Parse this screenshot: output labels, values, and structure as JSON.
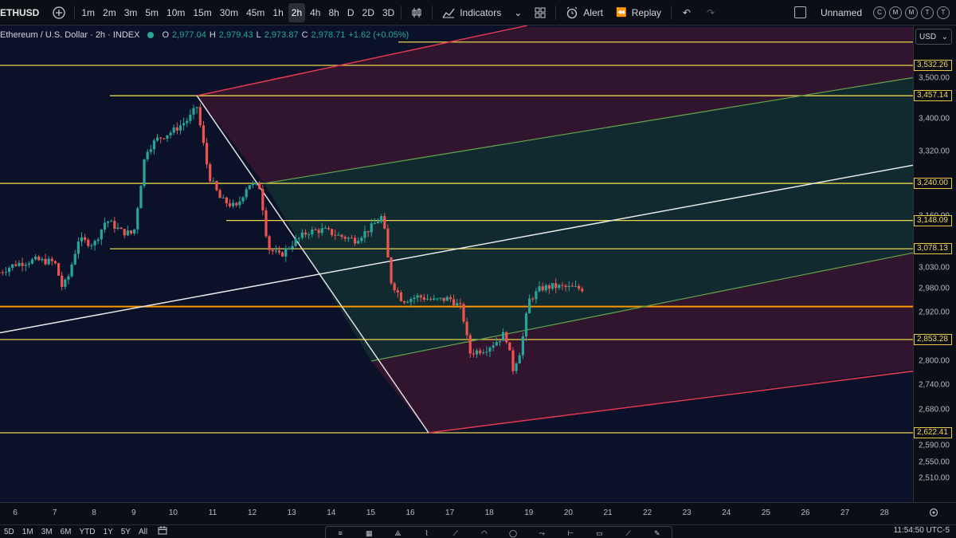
{
  "toolbar": {
    "symbol": "ETHUSD",
    "timeframes": [
      "1m",
      "2m",
      "3m",
      "5m",
      "10m",
      "15m",
      "30m",
      "45m",
      "1h",
      "2h",
      "4h",
      "8h",
      "D",
      "2D",
      "3D"
    ],
    "active_timeframe": "2h",
    "indicators_label": "Indicators",
    "alert_label": "Alert",
    "replay_label": "Replay",
    "layout_name": "Unnamed",
    "circle_buttons": [
      "C",
      "M",
      "M",
      "T",
      "T"
    ]
  },
  "legend": {
    "title": "Ethereum / U.S. Dollar · 2h · INDEX",
    "o_label": "O",
    "o": "2,977.04",
    "h_label": "H",
    "h": "2,979.43",
    "l_label": "L",
    "l": "2,973.87",
    "c_label": "C",
    "c": "2,978.71",
    "change": "+1.62 (+0.05%)"
  },
  "price_axis": {
    "currency": "USD",
    "ticks": [
      "3,500.00",
      "3,400.00",
      "3,320.00",
      "3,160.00",
      "3,030.00",
      "2,980.00",
      "2,920.00",
      "2,800.00",
      "2,740.00",
      "2,680.00",
      "2,590.00",
      "2,550.00",
      "2,510.00"
    ],
    "tags": [
      "3,532.26",
      "3,457.14",
      "3,240.00",
      "3,148.09",
      "3,078.13",
      "2,853.28",
      "2,622.41"
    ]
  },
  "time_axis": {
    "ticks": [
      "6",
      "7",
      "8",
      "9",
      "10",
      "11",
      "12",
      "13",
      "14",
      "15",
      "16",
      "17",
      "18",
      "19",
      "20",
      "21",
      "22",
      "23",
      "24",
      "25",
      "26",
      "27",
      "28"
    ]
  },
  "bottom_bar": {
    "ranges": [
      "5D",
      "1M",
      "3M",
      "6M",
      "YTD",
      "1Y",
      "5Y",
      "All"
    ],
    "clock": "11:54:50 UTC-5"
  },
  "colors": {
    "up": "#26a69a",
    "down": "#ef5350",
    "level_line": "#e8d44d",
    "key_level": "#ff9800",
    "channel_red": "#e53950",
    "channel_green": "#5e9e4a",
    "background": "#0b1128"
  },
  "chart_data": {
    "type": "candlestick",
    "symbol": "ETHUSD",
    "interval": "2h",
    "x_ticks": [
      "6",
      "7",
      "8",
      "9",
      "10",
      "11",
      "12",
      "13",
      "14",
      "15",
      "16",
      "17",
      "18",
      "19",
      "20",
      "21",
      "22",
      "23",
      "24",
      "25",
      "26",
      "27",
      "28"
    ],
    "horizontal_levels": [
      3532.26,
      3457.14,
      3240.0,
      3148.09,
      3078.13,
      2853.28,
      2622.41
    ],
    "key_level": 2935,
    "top_level": 3590,
    "last_close": 2978.71,
    "price_path": [
      [
        5.6,
        3020
      ],
      [
        6.0,
        3040
      ],
      [
        6.5,
        3050
      ],
      [
        7.0,
        3045
      ],
      [
        7.2,
        2980
      ],
      [
        7.35,
        3010
      ],
      [
        7.6,
        3100
      ],
      [
        8.0,
        3090
      ],
      [
        8.3,
        3150
      ],
      [
        8.7,
        3120
      ],
      [
        9.0,
        3115
      ],
      [
        9.3,
        3320
      ],
      [
        9.6,
        3350
      ],
      [
        10.0,
        3370
      ],
      [
        10.4,
        3400
      ],
      [
        10.6,
        3430
      ],
      [
        10.9,
        3260
      ],
      [
        11.2,
        3200
      ],
      [
        11.6,
        3180
      ],
      [
        11.9,
        3240
      ],
      [
        12.2,
        3230
      ],
      [
        12.4,
        3080
      ],
      [
        12.7,
        3060
      ],
      [
        13.0,
        3090
      ],
      [
        13.4,
        3120
      ],
      [
        13.8,
        3125
      ],
      [
        14.2,
        3110
      ],
      [
        14.6,
        3100
      ],
      [
        15.0,
        3130
      ],
      [
        15.3,
        3160
      ],
      [
        15.5,
        3000
      ],
      [
        15.8,
        2950
      ],
      [
        16.2,
        2960
      ],
      [
        16.6,
        2950
      ],
      [
        17.0,
        2955
      ],
      [
        17.3,
        2930
      ],
      [
        17.5,
        2820
      ],
      [
        17.9,
        2830
      ],
      [
        18.2,
        2850
      ],
      [
        18.4,
        2870
      ],
      [
        18.6,
        2780
      ],
      [
        18.8,
        2830
      ],
      [
        19.0,
        2950
      ],
      [
        19.3,
        2980
      ],
      [
        19.6,
        2985
      ],
      [
        20.0,
        2982
      ],
      [
        20.4,
        2978.71
      ]
    ]
  }
}
